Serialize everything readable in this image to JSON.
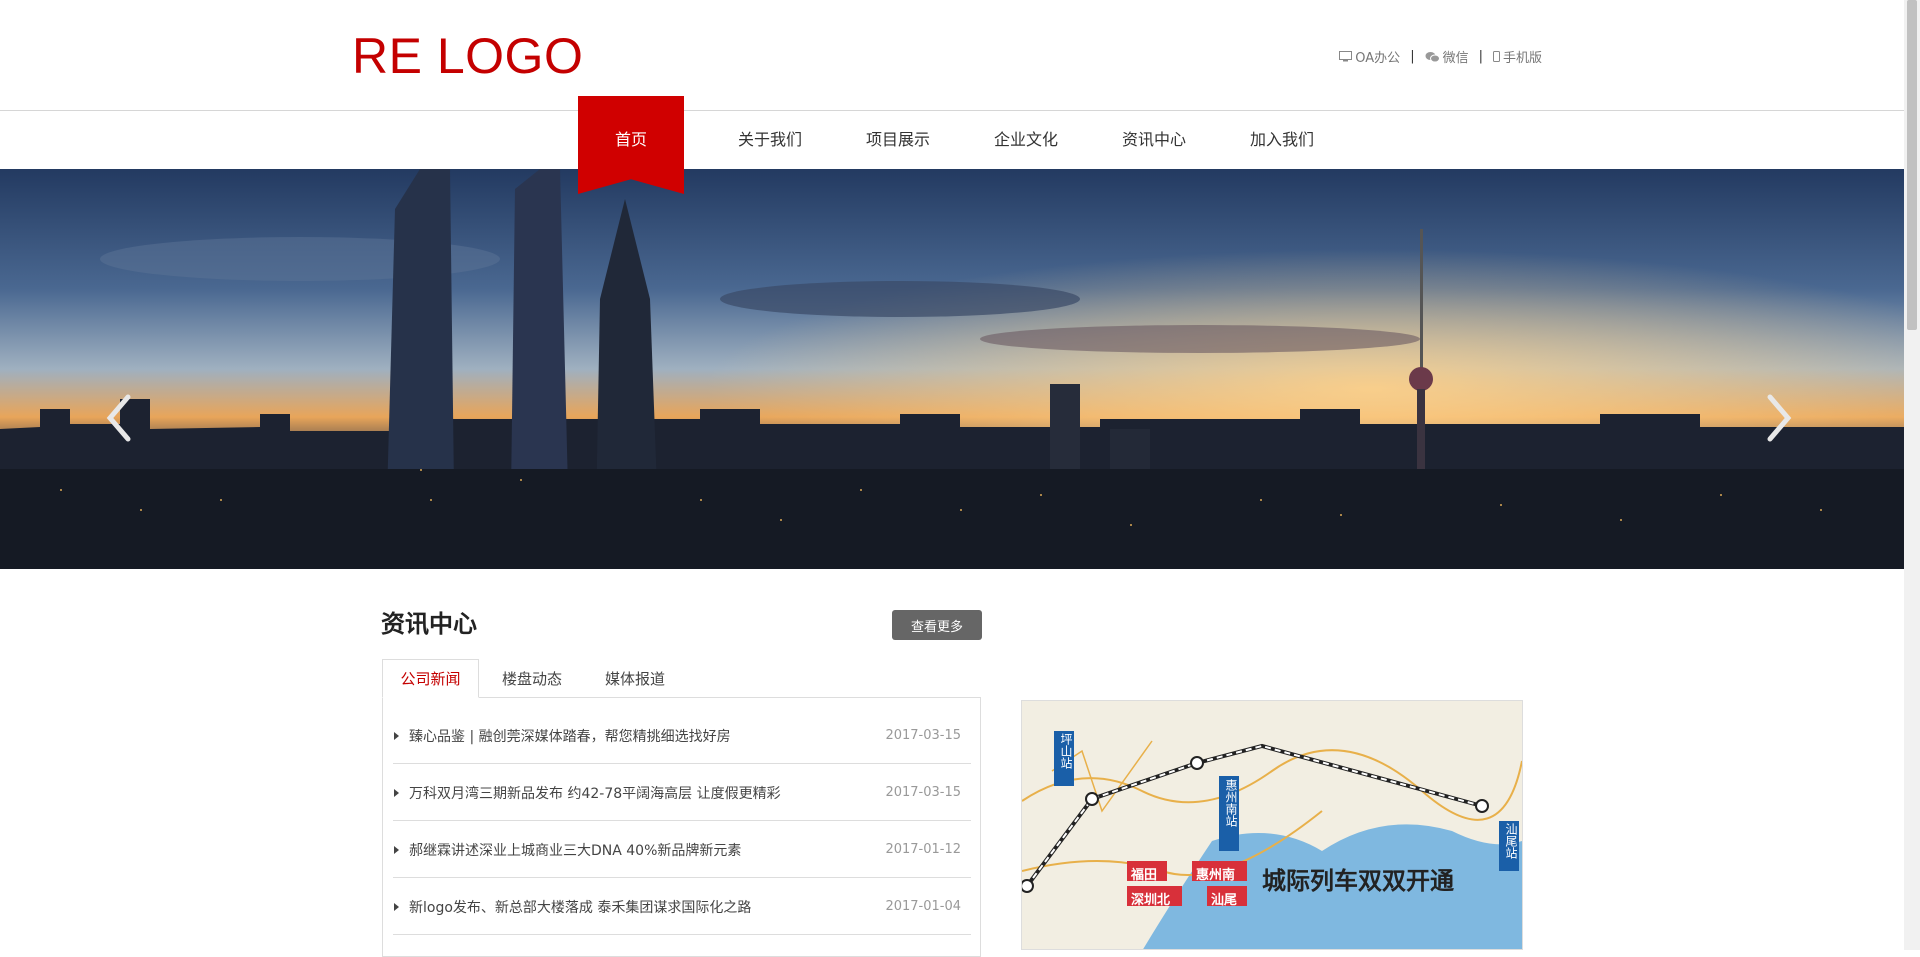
{
  "header": {
    "logo": "RE LOGO",
    "links": [
      {
        "icon": "monitor-icon",
        "label": "OA办公"
      },
      {
        "icon": "wechat-icon",
        "label": "微信"
      },
      {
        "icon": "mobile-icon",
        "label": "手机版"
      }
    ],
    "separator": "|"
  },
  "nav": {
    "items": [
      "首页",
      "关于我们",
      "项目展示",
      "企业文化",
      "资讯中心",
      "加入我们"
    ],
    "active_index": 0
  },
  "banner": {
    "prev_icon": "chevron-left-icon",
    "next_icon": "chevron-right-icon"
  },
  "news": {
    "title": "资讯中心",
    "more_label": "查看更多",
    "tabs": [
      "公司新闻",
      "楼盘动态",
      "媒体报道"
    ],
    "active_tab": 0,
    "items": [
      {
        "title": "臻心品鉴 | 融创莞深媒体踏春，帮您精挑细选找好房",
        "date": "2017-03-15"
      },
      {
        "title": "万科双月湾三期新品发布 约42-78平阔海高层 让度假更精彩",
        "date": "2017-03-15"
      },
      {
        "title": "郝继霖讲述深业上城商业三大DNA 40%新品牌新元素",
        "date": "2017-01-12"
      },
      {
        "title": "新logo发布、新总部大楼落成 泰禾集团谋求国际化之路",
        "date": "2017-01-04"
      }
    ]
  },
  "map": {
    "headline": "城际列车双双开通",
    "stations": [
      "坪山站",
      "惠州南站",
      "汕尾站"
    ],
    "labels": [
      "福田",
      "惠州南",
      "深圳北",
      "汕尾"
    ]
  },
  "colors": {
    "brand": "#c40000",
    "nav_active": "#d00000",
    "more_button": "#666666"
  }
}
